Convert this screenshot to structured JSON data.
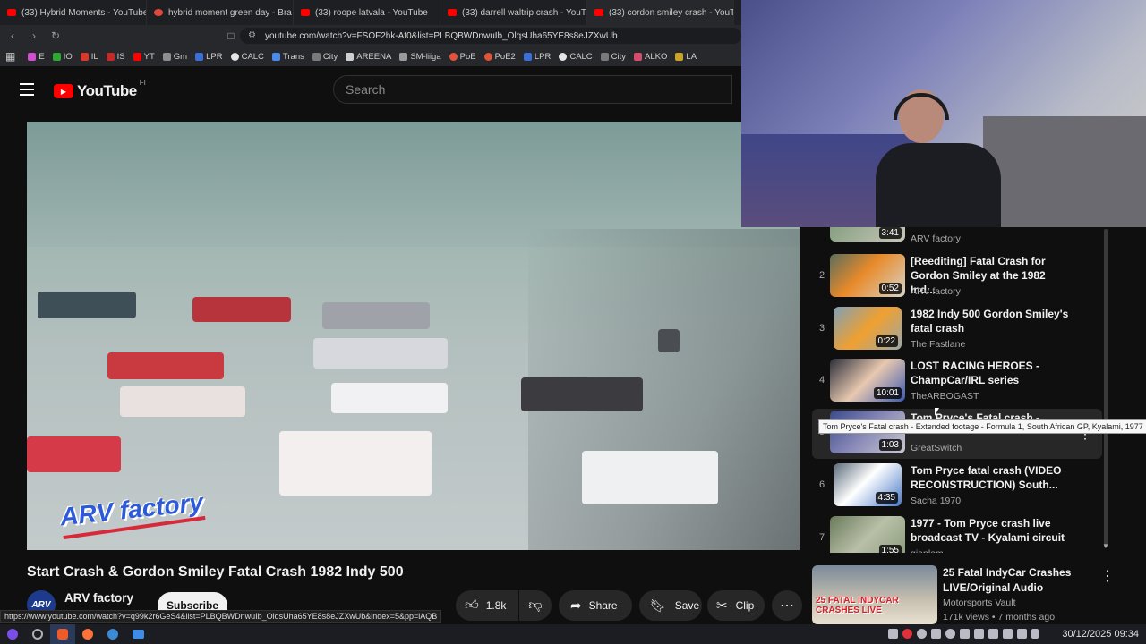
{
  "browser": {
    "tabs": [
      {
        "label": "(33) Hybrid Moments - YouTube",
        "color": "#ff0000"
      },
      {
        "label": "hybrid moment green day - Bra",
        "color": "#e04a3a"
      },
      {
        "label": "(33) roope latvala - YouTube",
        "color": "#ff0000"
      },
      {
        "label": "(33) darrell waltrip crash - YouTu",
        "color": "#ff0000"
      },
      {
        "label": "(33) cordon smiley crash - YouTu",
        "color": "#ff0000"
      }
    ],
    "url": "youtube.com/watch?v=FSOF2hk-Af0&list=PLBQBWDnwuIb_OlqsUha65YE8s8eJZXwUb",
    "bookmarks": [
      "E",
      "IO",
      "IL",
      "IS",
      "YT",
      "Gm",
      "LPR",
      "CALC",
      "Trans",
      "City",
      "AREENA",
      "SM-liiga",
      "PoE",
      "PoE2",
      "LPR",
      "CALC",
      "City",
      "ALKO",
      "LA"
    ]
  },
  "youtube": {
    "logo_text": "YouTube",
    "region": "FI",
    "search_placeholder": "Search"
  },
  "video": {
    "watermark": "ARV factory",
    "title": "Start Crash & Gordon Smiley Fatal Crash 1982 Indy 500",
    "channel": "ARV factory",
    "channel_avatar_text": "ARV",
    "subscribe_label": "Subscribe",
    "likes": "1.8k",
    "share_label": "Share",
    "save_label": "Save",
    "clip_label": "Clip"
  },
  "playlist": {
    "partial_top": {
      "duration": "3:41",
      "channel": "ARV factory"
    },
    "items": [
      {
        "index": "2",
        "title": "[Reediting] Fatal Crash for Gordon Smiley at the 1982 Ind...",
        "channel": "ARV factory",
        "duration": "0:52"
      },
      {
        "index": "3",
        "title": "1982 Indy 500 Gordon Smiley's fatal crash",
        "channel": "The Fastlane",
        "duration": "0:22"
      },
      {
        "index": "4",
        "title": "LOST RACING HEROES - ChampCar/IRL series",
        "channel": "TheARBOGAST",
        "duration": "10:01"
      },
      {
        "index": "5",
        "title": "Tom Pryce's Fatal crash -",
        "channel": "GreatSwitch",
        "duration": "1:03"
      },
      {
        "index": "6",
        "title": "Tom Pryce fatal crash (VIDEO RECONSTRUCTION) South...",
        "channel": "Sacha 1970",
        "duration": "4:35"
      },
      {
        "index": "7",
        "title": "1977 - Tom Pryce crash live broadcast TV - Kyalami circuit",
        "channel": "gianlem",
        "duration": "1:55"
      }
    ]
  },
  "tooltip": "Tom Pryce's Fatal crash - Extended footage - Formula 1, South African GP, Kyalami, 1977",
  "recommended": {
    "title": "25 Fatal IndyCar Crashes LIVE/Original Audio",
    "channel": "Motorsports Vault",
    "meta": "171k views • 7 months ago",
    "thumb_text": "25 FATAL INDYCAR CRASHES LIVE"
  },
  "status_url": "https://www.youtube.com/watch?v=q99k2r6GeS4&list=PLBQBWDnwuIb_OlqsUha65YE8s8eJZXwUb&index=5&pp=iAQB",
  "taskbar": {
    "clock": "30/12/2025 09:34"
  }
}
